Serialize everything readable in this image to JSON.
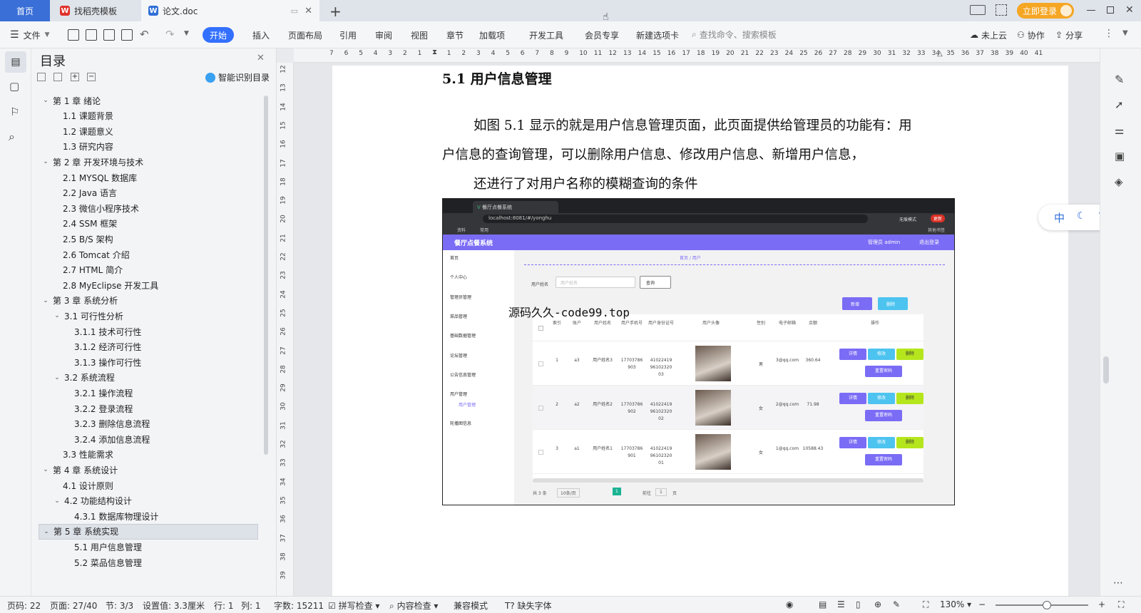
{
  "tabs": {
    "home": "首页",
    "template": "找稻壳模板",
    "doc": "论文.doc",
    "login": "立即登录"
  },
  "toolbar": {
    "file": "文件",
    "menus": [
      "开始",
      "插入",
      "页面布局",
      "引用",
      "审阅",
      "视图",
      "章节",
      "加载项",
      "开发工具",
      "会员专享",
      "新建选项卡"
    ],
    "search_placeholder": "查找命令、搜索模板",
    "cloud": "未上云",
    "collab": "协作",
    "share": "分享"
  },
  "toc": {
    "title": "目录",
    "smart": "智能识别目录",
    "items": [
      {
        "label": "第 1 章  绪论",
        "level": 1,
        "chev": "v"
      },
      {
        "label": "1.1  课题背景",
        "level": 2
      },
      {
        "label": "1.2  课题意义",
        "level": 2
      },
      {
        "label": "1.3  研究内容",
        "level": 2
      },
      {
        "label": "第 2 章  开发环境与技术",
        "level": 1,
        "chev": "v"
      },
      {
        "label": "2.1 MYSQL 数据库",
        "level": 2
      },
      {
        "label": "2.2 Java 语言",
        "level": 2
      },
      {
        "label": "2.3  微信小程序技术",
        "level": 2
      },
      {
        "label": "2.4 SSM 框架",
        "level": 2
      },
      {
        "label": "2.5 B/S 架构",
        "level": 2
      },
      {
        "label": "2.6 Tomcat  介绍",
        "level": 2
      },
      {
        "label": "2.7 HTML 简介",
        "level": 2
      },
      {
        "label": "2.8 MyEclipse 开发工具",
        "level": 2
      },
      {
        "label": "第 3 章  系统分析",
        "level": 1,
        "chev": "v"
      },
      {
        "label": "3.1  可行性分析",
        "level": 2,
        "chev": "v"
      },
      {
        "label": "3.1.1  技术可行性",
        "level": 3
      },
      {
        "label": "3.1.2  经济可行性",
        "level": 3
      },
      {
        "label": "3.1.3  操作可行性",
        "level": 3
      },
      {
        "label": "3.2  系统流程",
        "level": 2,
        "chev": "v"
      },
      {
        "label": "3.2.1  操作流程",
        "level": 3
      },
      {
        "label": "3.2.2  登录流程",
        "level": 3
      },
      {
        "label": "3.2.3  删除信息流程",
        "level": 3
      },
      {
        "label": "3.2.4  添加信息流程",
        "level": 3
      },
      {
        "label": "3.3  性能需求",
        "level": 2
      },
      {
        "label": "第 4 章  系统设计",
        "level": 1,
        "chev": "v"
      },
      {
        "label": "4.1  设计原则",
        "level": 2
      },
      {
        "label": "4.2  功能结构设计",
        "level": 2,
        "chev": "v"
      },
      {
        "label": "4.3.1  数据库物理设计",
        "level": 3
      },
      {
        "label": "第 5 章  系统实现",
        "level": 1,
        "chev": "v",
        "selected": true
      },
      {
        "label": "5.1 用户信息管理",
        "level": 3
      },
      {
        "label": "5.2  菜品信息管理",
        "level": 3
      }
    ]
  },
  "ruler": {
    "h": [
      "7",
      "6",
      "5",
      "4",
      "3",
      "2",
      "1",
      "",
      "1",
      "2",
      "3",
      "4",
      "5",
      "6",
      "7",
      "8",
      "9",
      "10",
      "11",
      "12",
      "13",
      "14",
      "15",
      "16",
      "17",
      "18",
      "19",
      "20",
      "21",
      "22",
      "23",
      "24",
      "25",
      "26",
      "27",
      "28",
      "29",
      "30",
      "31",
      "32",
      "33",
      "34",
      "35",
      "36",
      "37",
      "38",
      "39",
      "40",
      "41"
    ],
    "v": [
      "12",
      "13",
      "14",
      "15",
      "16",
      "17",
      "18",
      "19",
      "20",
      "21",
      "22",
      "23",
      "24",
      "25",
      "26",
      "27",
      "28",
      "29",
      "30",
      "31",
      "32",
      "33",
      "34",
      "35",
      "36",
      "37",
      "38",
      "39"
    ]
  },
  "doc": {
    "heading": "5.1 用户信息管理",
    "para1": "如图 5.1 显示的就是用户信息管理页面，此页面提供给管理员的功能有：用",
    "para2": "户信息的查询管理，可以删除用户信息、修改用户信息、新增用户信息，",
    "para3": "还进行了对用户名称的模糊查询的条件",
    "watermark": "源码久久-code99.top"
  },
  "shot": {
    "tab": "餐厅点餐系统",
    "url": "localhost:8081/#/yonghu",
    "bm1": "资料",
    "bm2": "常用",
    "bm3": "其他书签",
    "incognito": "无痕模式",
    "update": "更新",
    "app_title": "餐厅点餐系统",
    "admin": "管理员 admin",
    "logout": "退出登录",
    "menu": [
      "首页",
      "个人中心",
      "管理员管理",
      "菜品管理",
      "基础数据管理",
      "论坛管理",
      "公告信息管理",
      "用户管理",
      "用户管理",
      "轮播图信息"
    ],
    "crumb": "首页  /  用户",
    "search_label": "用户姓名",
    "search_ph": "用户姓名",
    "query": "查询",
    "add": "新增",
    "del": "删除",
    "cols": [
      "索引",
      "账户",
      "用户姓名",
      "用户手机号",
      "用户身份证号",
      "用户头像",
      "性别",
      "电子邮箱",
      "余额",
      "操作"
    ],
    "rows": [
      {
        "idx": "1",
        "acc": "a3",
        "name": "用户姓名3",
        "phone": "17703786903",
        "id": "410224199610232003",
        "sex": "男",
        "mail": "3@qq.com",
        "bal": "360.64"
      },
      {
        "idx": "2",
        "acc": "a2",
        "name": "用户姓名2",
        "phone": "17703786902",
        "id": "410224199610232002",
        "sex": "女",
        "mail": "2@qq.com",
        "bal": "71.98"
      },
      {
        "idx": "3",
        "acc": "a1",
        "name": "用户姓名1",
        "phone": "17703786901",
        "id": "410224199610232001",
        "sex": "女",
        "mail": "1@qq.com",
        "bal": "10588.43"
      }
    ],
    "ops": [
      "详情",
      "修改",
      "删除",
      "重置密码"
    ],
    "total": "共 3 条",
    "perpage": "10条/页",
    "page": "1",
    "goto": "前往",
    "goto_val": "1",
    "goto_unit": "页"
  },
  "float": {
    "zh": "中"
  },
  "status": {
    "pageno": "页码: 22",
    "pages": "页面: 27/40",
    "section": "节: 3/3",
    "setting": "设置值: 3.3厘米",
    "row": "行: 1",
    "col": "列: 1",
    "words": "字数: 15211",
    "spell": "拼写检查",
    "content": "内容检查",
    "compat": "兼容模式",
    "font": "缺失字体",
    "zoom": "130%"
  },
  "colors": {
    "accent": "#3370ff",
    "purple": "#7b6cf6",
    "cyan": "#4dc3f0",
    "lime": "#b5e61d"
  }
}
